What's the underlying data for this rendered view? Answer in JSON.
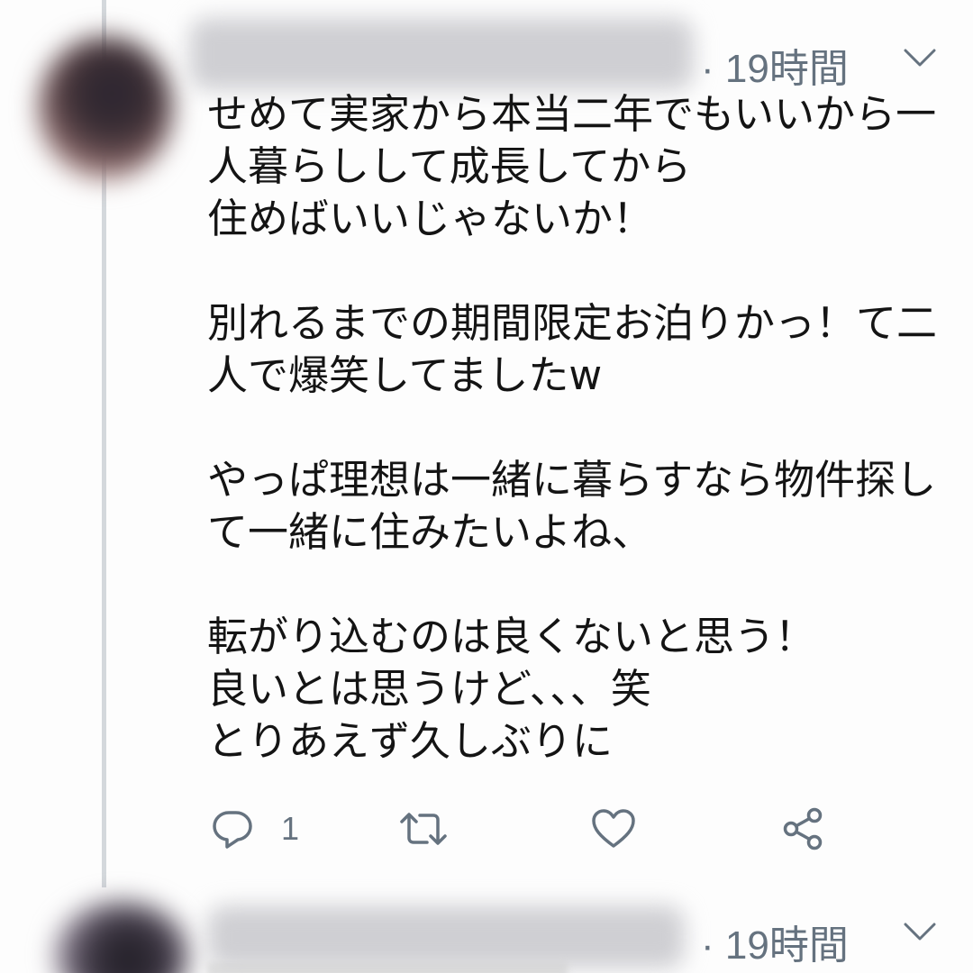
{
  "tweet1": {
    "time": "· 19時間",
    "paragraphs": [
      [
        "せめて実家から本当二年でもいいから一",
        "人暮らしして成長してから",
        "住めばいいじゃないか！"
      ],
      [
        "別れるまでの期間限定お泊りかっ！て二",
        "人で爆笑してましたw"
      ],
      [
        "やっぱ理想は一緒に暮らすなら物件探し",
        "て一緒に住みたいよね、"
      ],
      [
        "転がり込むのは良くないと思う！",
        "良いとは思うけど、、、笑",
        "とりあえず久しぶりに"
      ]
    ],
    "actions": {
      "reply_count": "1"
    }
  },
  "tweet2": {
    "time": "· 19時間"
  },
  "icons": {
    "menu": "chevron-down-icon",
    "reply": "reply-icon",
    "retweet": "retweet-icon",
    "like": "heart-icon",
    "share": "share-icon"
  },
  "colors": {
    "meta": "#65727f",
    "icon": "#65727f",
    "thread_line": "#d4d8dc"
  }
}
